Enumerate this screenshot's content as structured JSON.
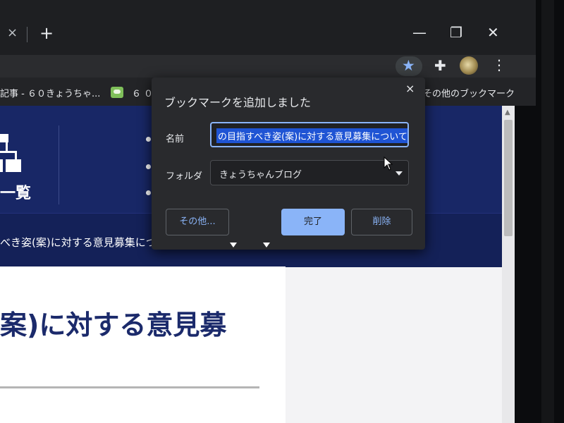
{
  "browser": {
    "tab_close_glyph": "×",
    "new_tab_glyph": "+",
    "window_controls": {
      "minimize": "—",
      "maximize": "❐",
      "close": "✕"
    },
    "toolbar": {
      "star_icon": "star-icon",
      "star_glyph": "★",
      "extensions_glyph": "✚",
      "menu_glyph": "⋮",
      "accent_color": "#8ab4f8"
    }
  },
  "bookmarks_bar": {
    "items": [
      {
        "label": "記事 - ６０きょうちゃ..."
      },
      {
        "label": "６０"
      },
      {
        "label": "その他のブックマーク"
      }
    ]
  },
  "page": {
    "hero_list_label": "一覧",
    "hero_title": "べき姿(案)に対する意見募集について",
    "article_title": "案)に対する意見募",
    "hero_color": "#182766"
  },
  "dialog": {
    "title": "ブックマークを追加しました",
    "close_glyph": "×",
    "name_label": "名前",
    "name_value": "の目指すべき姿(案)に対する意見募集について",
    "folder_label": "フォルダ",
    "folder_value": "きょうちゃんブログ",
    "buttons": {
      "more": "その他...",
      "done": "完了",
      "delete": "削除"
    }
  }
}
